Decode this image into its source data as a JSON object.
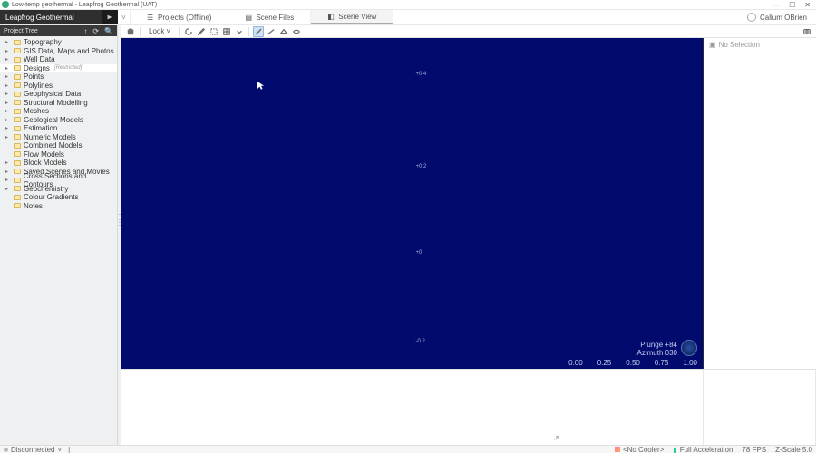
{
  "window": {
    "title": "Low-temp geothermal - Leapfrog Geothermal (UAT)",
    "controls": {
      "min": "—",
      "max": "☐",
      "close": "✕"
    }
  },
  "brand": "Leapfrog Geothermal",
  "tabs": [
    {
      "label": "Projects (Offline)",
      "icon": "stack-icon"
    },
    {
      "label": "Scene Files",
      "icon": "files-icon"
    },
    {
      "label": "Scene View",
      "icon": "cube-icon",
      "active": true
    }
  ],
  "user": {
    "name": "Callum OBrien"
  },
  "tree": {
    "header": "Project Tree",
    "items": [
      {
        "label": "Topography",
        "caret": true
      },
      {
        "label": "GIS Data, Maps and Photos",
        "caret": true
      },
      {
        "label": "Well Data",
        "caret": true
      },
      {
        "label": "Designs",
        "caret": true,
        "restricted": "[Restricted]",
        "selected": true
      },
      {
        "label": "Points",
        "caret": true
      },
      {
        "label": "Polylines",
        "caret": true
      },
      {
        "label": "Geophysical Data",
        "caret": true
      },
      {
        "label": "Structural Modelling",
        "caret": true
      },
      {
        "label": "Meshes",
        "caret": true
      },
      {
        "label": "Geological Models",
        "caret": true
      },
      {
        "label": "Estimation",
        "caret": true
      },
      {
        "label": "Numeric Models",
        "caret": true
      },
      {
        "label": "Combined Models",
        "caret": false
      },
      {
        "label": "Flow Models",
        "caret": false
      },
      {
        "label": "Block Models",
        "caret": true
      },
      {
        "label": "Saved Scenes and Movies",
        "caret": true
      },
      {
        "label": "Cross Sections and Contours",
        "caret": true
      },
      {
        "label": "Geochemistry",
        "caret": true
      },
      {
        "label": "Colour Gradients",
        "caret": false
      },
      {
        "label": "Notes",
        "caret": false
      }
    ]
  },
  "toolbar": {
    "look_label": "Look"
  },
  "viewport": {
    "ticks": [
      {
        "label": "+0.4",
        "top": "10%"
      },
      {
        "label": "+0.2",
        "top": "38%"
      },
      {
        "label": "+0",
        "top": "64%"
      },
      {
        "label": "-0.2",
        "top": "91%"
      }
    ],
    "readout": {
      "plunge": "Plunge +84",
      "azimuth": "Azimuth 030"
    },
    "ruler": [
      "0.00",
      "0.25",
      "0.50",
      "0.75",
      "1.00"
    ]
  },
  "selection": {
    "header": "No Selection"
  },
  "status": {
    "conn": "Disconnected",
    "conn_caret": "˅",
    "divider": "|",
    "cooler": "<No Cooler>",
    "accel": "Full Acceleration",
    "fps": "78 FPS",
    "zscale": "Z-Scale 5.0"
  }
}
